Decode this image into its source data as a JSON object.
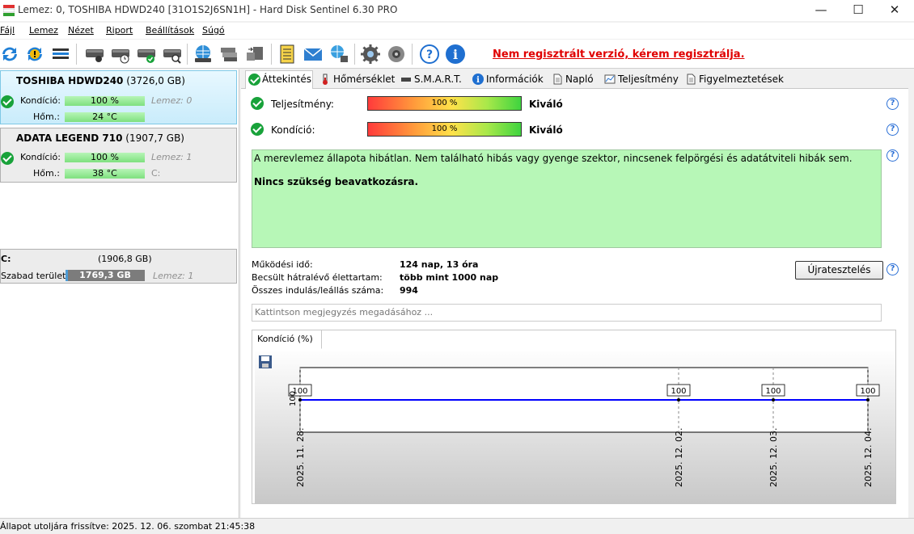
{
  "window": {
    "title": "Lemez: 0, TOSHIBA HDWD240 [31O1S2J6SN1H]  -  Hard Disk Sentinel 6.30 PRO",
    "minimize": "—",
    "maximize": "☐",
    "close": "✕"
  },
  "menu": [
    "Fájl",
    "Lemez",
    "Nézet",
    "Riport",
    "Beállítások",
    "Súgó"
  ],
  "toolbar": {
    "icons": [
      "refresh-icon",
      "refresh-warning-icon",
      "disk-list-icon",
      "disk-icon",
      "disk-clock-icon",
      "disk-check-icon",
      "disk-search-icon",
      "globe-disk-icon",
      "disk-stack-icon",
      "disk-transfer-icon",
      "notes-icon",
      "mail-icon",
      "network-icon",
      "gear-icon",
      "speaker-icon",
      "help-icon",
      "info-icon"
    ],
    "registration_text": "Nem regisztrált verzió, kérem regisztrálja."
  },
  "disks": [
    {
      "name": "TOSHIBA HDWD240",
      "size": "(3726,0 GB)",
      "condition_label": "Kondíció:",
      "condition": "100 %",
      "temp_label": "Hőm.:",
      "temp": "24 °C",
      "index_text": "Lemez: 0",
      "extra": ""
    },
    {
      "name": "ADATA LEGEND 710",
      "size": "(1907,7 GB)",
      "condition_label": "Kondíció:",
      "condition": "100 %",
      "temp_label": "Hőm.:",
      "temp": "38 °C",
      "index_text": "Lemez: 1",
      "extra": "C:"
    }
  ],
  "partition": {
    "letter": "C:",
    "size": "(1906,8 GB)",
    "free_label": "Szabad terület",
    "free": "1769,3 GB",
    "disk": "Lemez: 1"
  },
  "tabs": [
    "Áttekintés",
    "Hőmérséklet",
    "S.M.A.R.T.",
    "Információk",
    "Napló",
    "Teljesítmény",
    "Figyelmeztetések"
  ],
  "overview": {
    "performance_label": "Teljesítmény:",
    "performance_value": "100 %",
    "performance_fraction": 1.0,
    "performance_rating": "Kiváló",
    "health_label": "Kondíció:",
    "health_value": "100 %",
    "health_fraction": 1.0,
    "health_rating": "Kiváló",
    "message": "A merevlemez állapota hibátlan. Nem található hibás vagy gyenge szektor, nincsenek felpörgési és adatátviteli hibák sem.",
    "recommendation": "Nincs szükség beavatkozásra.",
    "power_on_label": "Működési idő:",
    "power_on_value": "124 nap, 13 óra",
    "remaining_label": "Becsült hátralévő élettartam:",
    "remaining_value": "több mint 1000 nap",
    "starts_label": "Összes indulás/leállás száma:",
    "starts_value": "994",
    "retest_button": "Újratesztelés",
    "note_placeholder": "Kattintson megjegyzés megadásához ..."
  },
  "chart_tab": "Kondíció  (%)",
  "chart_data": {
    "type": "line",
    "title": "",
    "x": [
      "2025. 11. 28.",
      "2025. 12. 02.",
      "2025. 12. 03.",
      "2025. 12. 04."
    ],
    "series": [
      {
        "name": "",
        "values": [
          100,
          100,
          100,
          100
        ]
      }
    ],
    "ytick": "100",
    "color": "#0000ff"
  },
  "status": "Állapot utoljára frissítve: 2025. 12. 06. szombat 21:45:38"
}
